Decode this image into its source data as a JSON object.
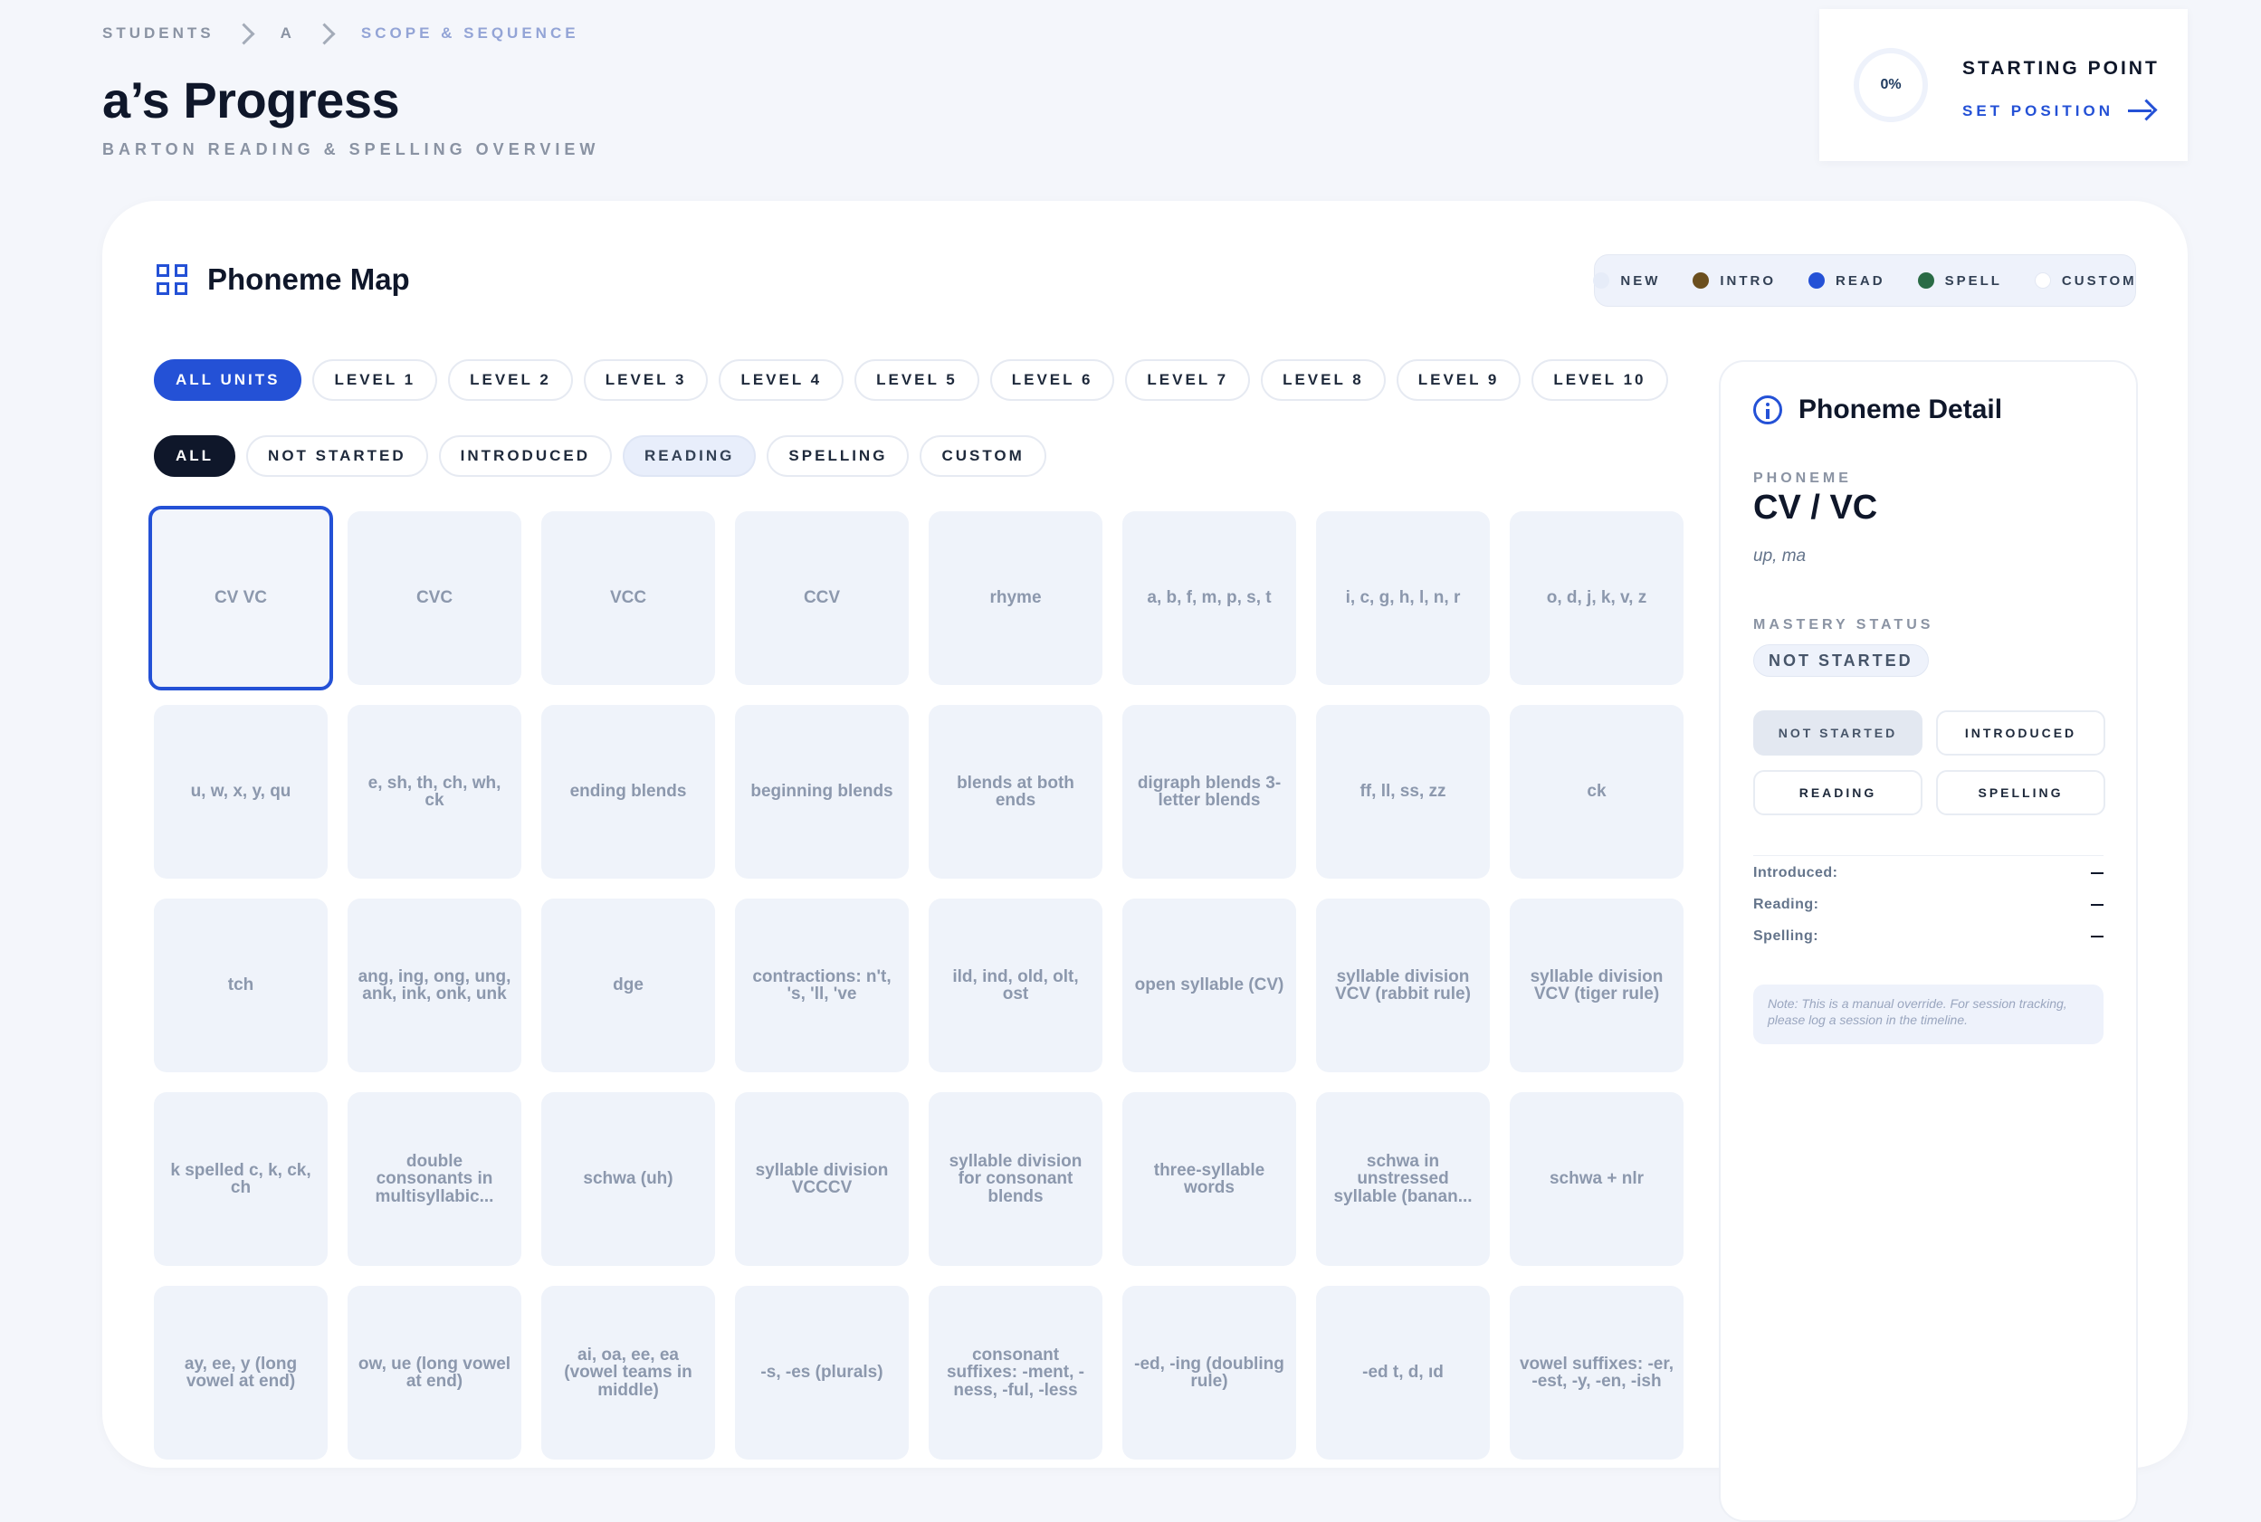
{
  "breadcrumb": [
    "STUDENTS",
    "A",
    "SCOPE & SEQUENCE"
  ],
  "page": {
    "title": "a’s Progress",
    "subtitle": "BARTON READING & SPELLING OVERVIEW"
  },
  "starting_point": {
    "percent": "0%",
    "title": "STARTING POINT",
    "action": "SET POSITION"
  },
  "phoneme_map": {
    "title": "Phoneme Map",
    "legend": [
      {
        "label": "NEW",
        "color": "#e6ecf8"
      },
      {
        "label": "INTRO",
        "color": "#6b4f1e"
      },
      {
        "label": "READ",
        "color": "#2451d6"
      },
      {
        "label": "SPELL",
        "color": "#2a6b45"
      },
      {
        "label": "CUSTOM",
        "color": "#ffffff"
      }
    ],
    "levels": [
      "ALL UNITS",
      "LEVEL 1",
      "LEVEL 2",
      "LEVEL 3",
      "LEVEL 4",
      "LEVEL 5",
      "LEVEL 6",
      "LEVEL 7",
      "LEVEL 8",
      "LEVEL 9",
      "LEVEL 10"
    ],
    "filters": [
      "ALL",
      "NOT STARTED",
      "INTRODUCED",
      "READING",
      "SPELLING",
      "CUSTOM"
    ],
    "tiles": [
      "CV VC",
      "CVC",
      "VCC",
      "CCV",
      "rhyme",
      "a, b, f, m, p, s, t",
      "i, c, g, h, l, n, r",
      "o, d, j, k, v, z",
      "u, w, x, y, qu",
      "e, sh, th, ch, wh, ck",
      "ending blends",
      "beginning blends",
      "blends at both ends",
      "digraph blends 3-letter blends",
      "ff, ll, ss, zz",
      "ck",
      "tch",
      "ang, ing, ong, ung, ank, ink, onk, unk",
      "dge",
      "contractions: n't, 's, 'll, 've",
      "ild, ind, old, olt, ost",
      "open syllable (CV)",
      "syllable division VCV (rabbit rule)",
      "syllable division VCV (tiger rule)",
      "k spelled c, k, ck, ch",
      "double consonants in multisyllabic...",
      "schwa (uh)",
      "syllable division VCCCV",
      "syllable division for consonant blends",
      "three-syllable words",
      "schwa in unstressed syllable (banan...",
      "schwa + nlr",
      "ay, ee, y (long vowel at end)",
      "ow, ue (long vowel at end)",
      "ai, oa, ee, ea (vowel teams in middle)",
      "-s, -es (plurals)",
      "consonant suffixes: -ment, -ness, -ful, -less",
      "-ed, -ing (doubling rule)",
      "-ed t, d, ıd",
      "vowel suffixes: -er, -est, -y, -en, -ish"
    ]
  },
  "detail": {
    "title": "Phoneme Detail",
    "phoneme_label": "PHONEME",
    "phoneme": "CV / VC",
    "examples": "up, ma",
    "mastery_label": "MASTERY STATUS",
    "status": "NOT STARTED",
    "status_options": [
      "NOT STARTED",
      "INTRODUCED",
      "READING",
      "SPELLING"
    ],
    "rows": [
      {
        "label": "Introduced:"
      },
      {
        "label": "Reading:"
      },
      {
        "label": "Spelling:"
      }
    ],
    "note": "Note: This is a manual override. For session tracking, please log a session in the timeline."
  }
}
